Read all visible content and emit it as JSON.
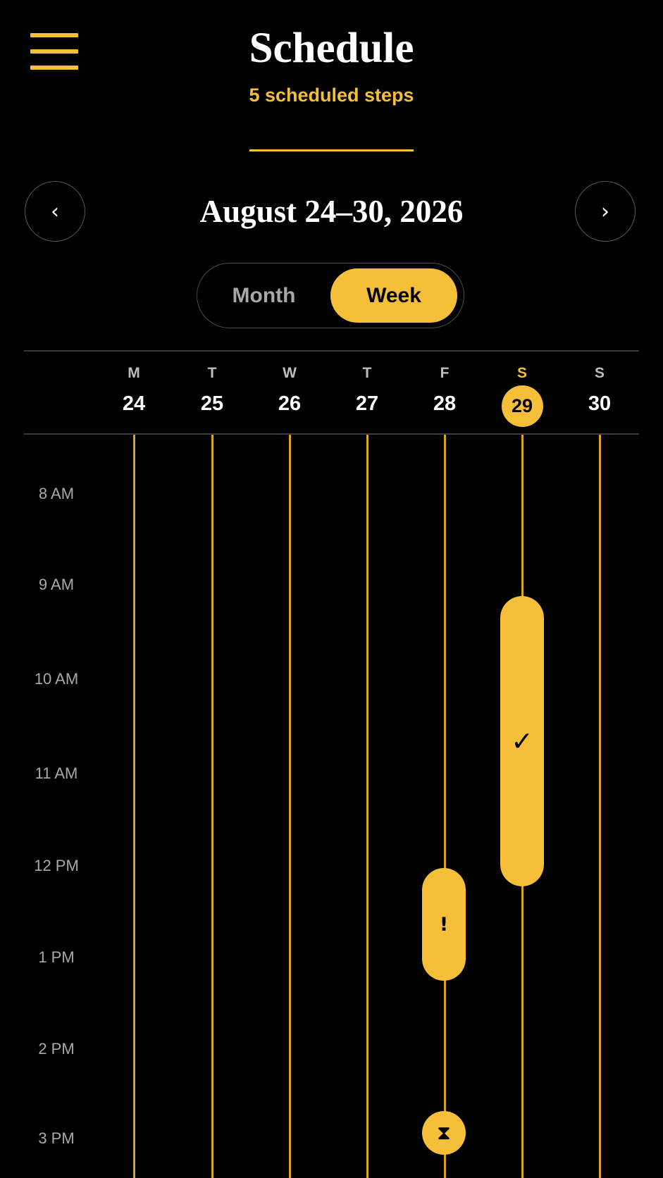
{
  "header": {
    "title": "Schedule",
    "subtitle": "5 scheduled steps",
    "menu_icon": "hamburger-menu-icon"
  },
  "week_nav": {
    "range": "August 24–30, 2026",
    "prev_icon": "chevron-left-icon",
    "next_icon": "chevron-right-icon"
  },
  "view_toggle": {
    "options": [
      "Month",
      "Week"
    ],
    "selected": "Week"
  },
  "days": [
    {
      "letter": "M",
      "date": "24",
      "today": false
    },
    {
      "letter": "T",
      "date": "25",
      "today": false
    },
    {
      "letter": "W",
      "date": "26",
      "today": false
    },
    {
      "letter": "T",
      "date": "27",
      "today": false
    },
    {
      "letter": "F",
      "date": "28",
      "today": false
    },
    {
      "letter": "S",
      "date": "29",
      "today": true
    },
    {
      "letter": "S",
      "date": "30",
      "today": false
    }
  ],
  "time_labels": [
    "8 AM",
    "9 AM",
    "10 AM",
    "11 AM",
    "12 PM",
    "1 PM",
    "2 PM",
    "3 PM"
  ],
  "events": [
    {
      "day": "29",
      "icon": "checkmark-icon",
      "glyph": "✓"
    },
    {
      "day": "28",
      "icon": "exclamation-icon",
      "glyph": "!"
    },
    {
      "day": "28",
      "icon": "hourglass-icon",
      "glyph": "⧗"
    }
  ],
  "colors": {
    "accent": "#f5bf39",
    "background": "#000000",
    "text": "#ffffff",
    "muted": "#a9a9a9"
  }
}
